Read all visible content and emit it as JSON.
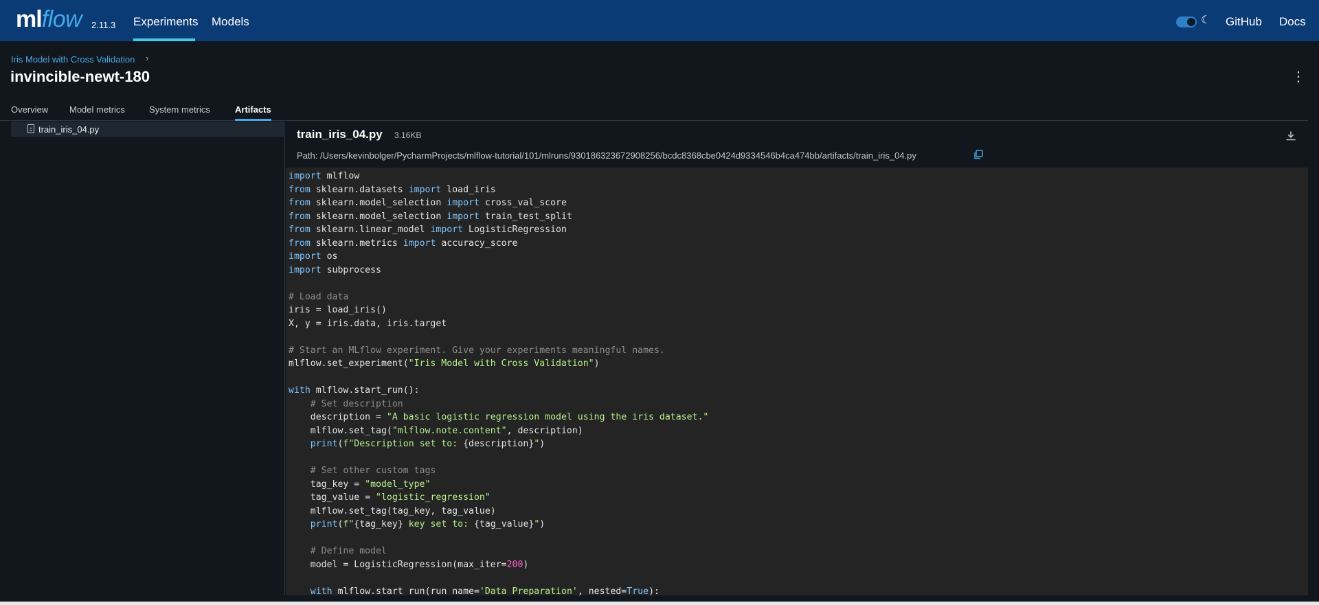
{
  "header": {
    "logo_ml": "ml",
    "logo_flow": "flow",
    "version": "2.11.3",
    "nav": [
      "Experiments",
      "Models"
    ],
    "github": "GitHub",
    "docs": "Docs",
    "theme_toggle_on": true
  },
  "breadcrumb": "Iris Model with Cross Validation",
  "run_title": "invincible-newt-180",
  "tabs": [
    "Overview",
    "Model metrics",
    "System metrics",
    "Artifacts"
  ],
  "active_tab": "Artifacts",
  "tree": {
    "items": [
      "train_iris_04.py"
    ]
  },
  "file": {
    "name": "train_iris_04.py",
    "size": "3.16KB",
    "path": "Path: /Users/kevinbolger/PycharmProjects/mlflow-tutorial/101/mlruns/930186323672908256/bcdc8368cbe0424d9334546b4ca474bb/artifacts/train_iris_04.py"
  },
  "code_lines": [
    [
      [
        "kw",
        "import"
      ],
      [
        "t",
        " mlflow"
      ]
    ],
    [
      [
        "kw",
        "from"
      ],
      [
        "t",
        " sklearn.datasets "
      ],
      [
        "kw",
        "import"
      ],
      [
        "t",
        " load_iris"
      ]
    ],
    [
      [
        "kw",
        "from"
      ],
      [
        "t",
        " sklearn.model_selection "
      ],
      [
        "kw",
        "import"
      ],
      [
        "t",
        " cross_val_score"
      ]
    ],
    [
      [
        "kw",
        "from"
      ],
      [
        "t",
        " sklearn.model_selection "
      ],
      [
        "kw",
        "import"
      ],
      [
        "t",
        " train_test_split"
      ]
    ],
    [
      [
        "kw",
        "from"
      ],
      [
        "t",
        " sklearn.linear_model "
      ],
      [
        "kw",
        "import"
      ],
      [
        "t",
        " LogisticRegression"
      ]
    ],
    [
      [
        "kw",
        "from"
      ],
      [
        "t",
        " sklearn.metrics "
      ],
      [
        "kw",
        "import"
      ],
      [
        "t",
        " accuracy_score"
      ]
    ],
    [
      [
        "kw",
        "import"
      ],
      [
        "t",
        " os"
      ]
    ],
    [
      [
        "kw",
        "import"
      ],
      [
        "t",
        " subprocess"
      ]
    ],
    [
      [
        "t",
        ""
      ]
    ],
    [
      [
        "cm",
        "# Load data"
      ]
    ],
    [
      [
        "t",
        "iris = load_iris()"
      ]
    ],
    [
      [
        "t",
        "X, y = iris.data, iris.target"
      ]
    ],
    [
      [
        "t",
        ""
      ]
    ],
    [
      [
        "cm",
        "# Start an MLflow experiment. Give your experiments meaningful names."
      ]
    ],
    [
      [
        "t",
        "mlflow.set_experiment("
      ],
      [
        "str",
        "\"Iris Model with Cross Validation\""
      ],
      [
        "t",
        ")"
      ]
    ],
    [
      [
        "t",
        ""
      ]
    ],
    [
      [
        "kw",
        "with"
      ],
      [
        "t",
        " mlflow.start_run():"
      ]
    ],
    [
      [
        "t",
        "    "
      ],
      [
        "cm",
        "# Set description"
      ]
    ],
    [
      [
        "t",
        "    description = "
      ],
      [
        "str",
        "\"A basic logistic regression model using the iris dataset.\""
      ]
    ],
    [
      [
        "t",
        "    mlflow.set_tag("
      ],
      [
        "str",
        "\"mlflow.note.content\""
      ],
      [
        "t",
        ", description)"
      ]
    ],
    [
      [
        "t",
        "    "
      ],
      [
        "fn",
        "print"
      ],
      [
        "t",
        "("
      ],
      [
        "str",
        "f\"Description set to: "
      ],
      [
        "t",
        "{description}"
      ],
      [
        "str",
        "\""
      ],
      [
        "t",
        ")"
      ]
    ],
    [
      [
        "t",
        ""
      ]
    ],
    [
      [
        "t",
        "    "
      ],
      [
        "cm",
        "# Set other custom tags"
      ]
    ],
    [
      [
        "t",
        "    tag_key = "
      ],
      [
        "str",
        "\"model_type\""
      ]
    ],
    [
      [
        "t",
        "    tag_value = "
      ],
      [
        "str",
        "\"logistic_regression\""
      ]
    ],
    [
      [
        "t",
        "    mlflow.set_tag(tag_key, tag_value)"
      ]
    ],
    [
      [
        "t",
        "    "
      ],
      [
        "fn",
        "print"
      ],
      [
        "t",
        "("
      ],
      [
        "str",
        "f\""
      ],
      [
        "t",
        "{tag_key}"
      ],
      [
        "str",
        " key set to: "
      ],
      [
        "t",
        "{tag_value}"
      ],
      [
        "str",
        "\""
      ],
      [
        "t",
        ")"
      ]
    ],
    [
      [
        "t",
        ""
      ]
    ],
    [
      [
        "t",
        "    "
      ],
      [
        "cm",
        "# Define model"
      ]
    ],
    [
      [
        "t",
        "    model = LogisticRegression(max_iter="
      ],
      [
        "num",
        "200"
      ],
      [
        "t",
        ")"
      ]
    ],
    [
      [
        "t",
        ""
      ]
    ],
    [
      [
        "t",
        "    "
      ],
      [
        "kw",
        "with"
      ],
      [
        "t",
        " mlflow.start_run(run_name="
      ],
      [
        "str",
        "'Data Preparation'"
      ],
      [
        "t",
        ", nested="
      ],
      [
        "kw",
        "True"
      ],
      [
        "t",
        "):"
      ]
    ]
  ]
}
